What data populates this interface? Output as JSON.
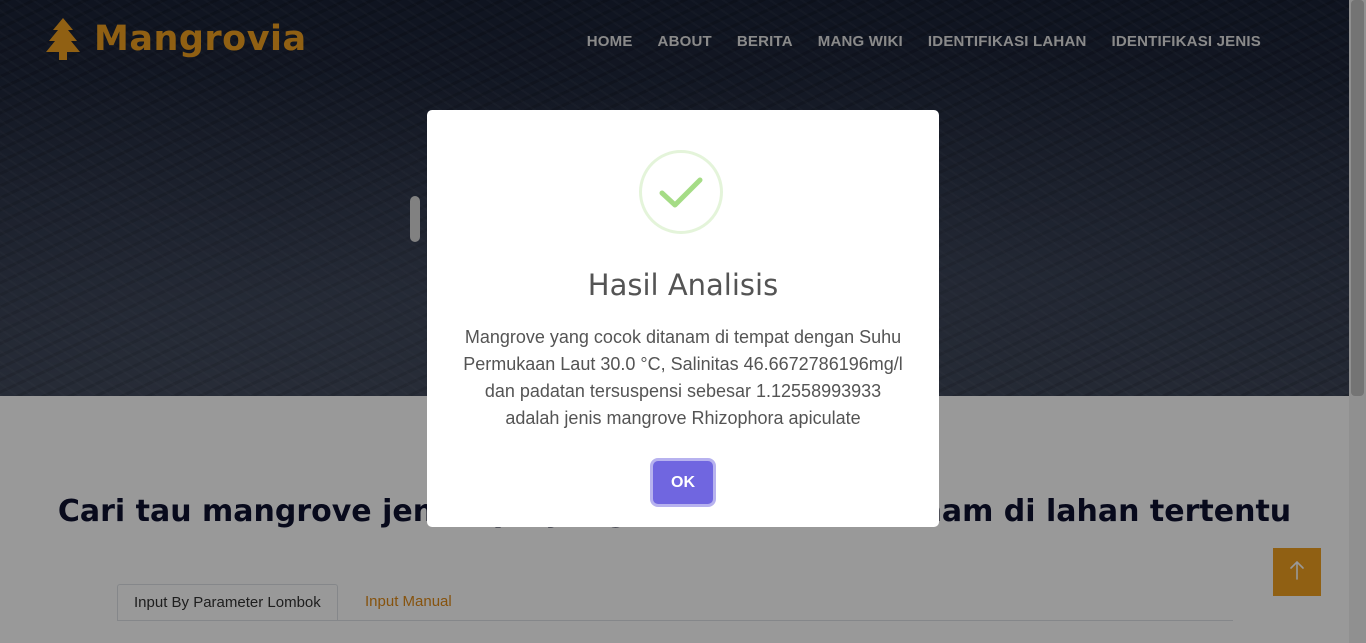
{
  "brand": {
    "name": "Mangrovia",
    "icon": "tree-icon",
    "color": "#f0a020"
  },
  "nav": {
    "items": [
      "HOME",
      "ABOUT",
      "BERITA",
      "MANG WIKI",
      "IDENTIFIKASI LAHAN",
      "IDENTIFIKASI JENIS"
    ]
  },
  "main": {
    "title": "Cari tau mangrove jenis apa yang cocok untuk ditanam di lahan tertentu",
    "tabs": [
      {
        "label": "Input By Parameter Lombok",
        "active": true
      },
      {
        "label": "Input Manual",
        "active": false
      }
    ]
  },
  "back_to_top": {
    "icon": "arrow-up-icon"
  },
  "modal": {
    "icon": "success-check-icon",
    "title": "Hasil Analisis",
    "text": "Mangrove yang cocok ditanam di tempat dengan Suhu Permukaan Laut 30.0 °C, Salinitas 46.6672786196mg/l dan padatan tersuspensi sebesar 1.12558993933 adalah jenis mangrove Rhizophora apiculate",
    "confirm_label": "OK",
    "confirm_color": "#7066e0"
  }
}
